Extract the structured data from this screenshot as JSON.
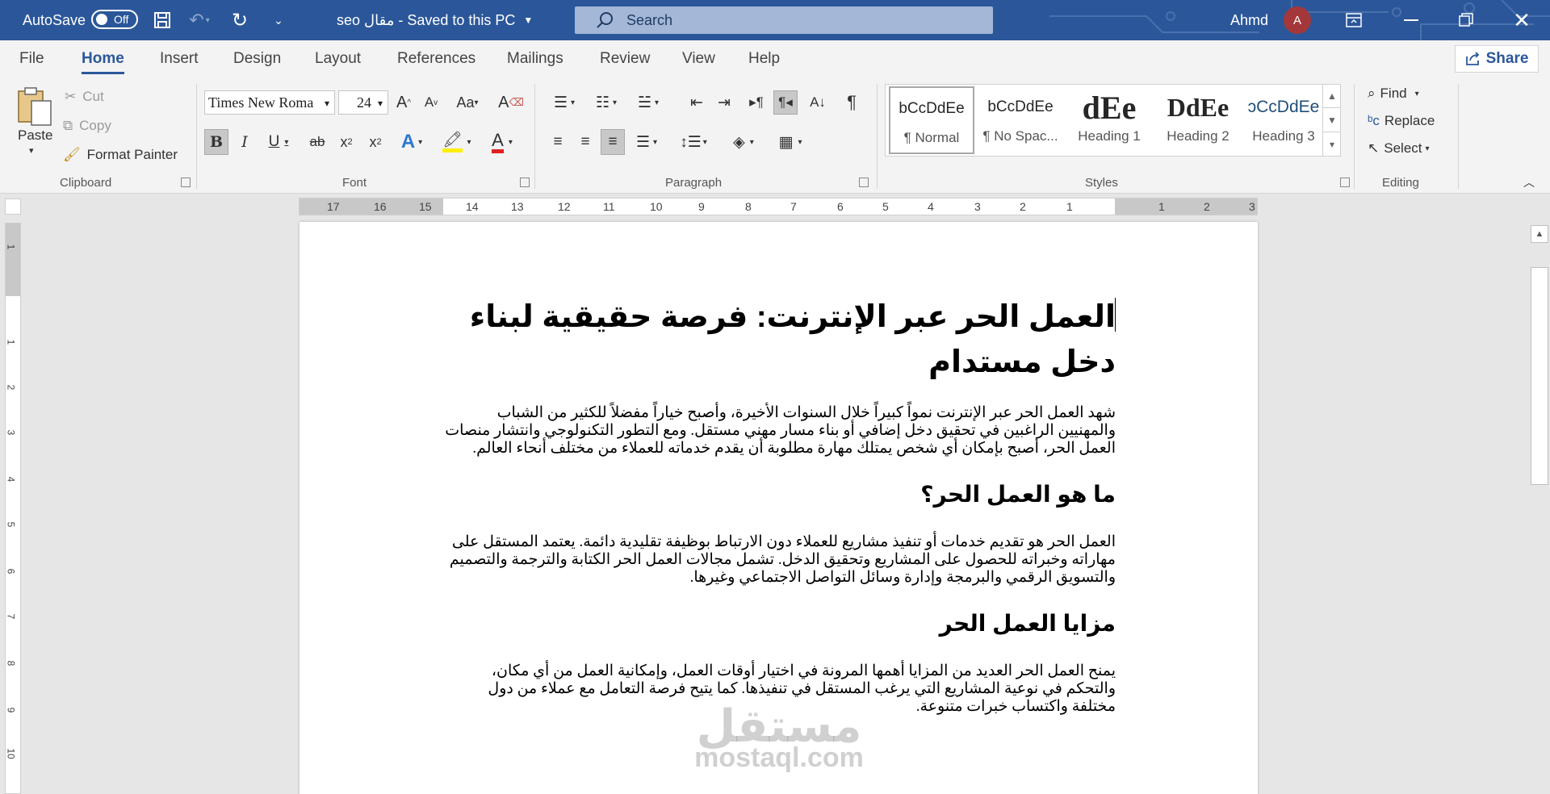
{
  "titlebar": {
    "autosave_label": "AutoSave",
    "autosave_state": "Off",
    "doc_title": "seo مقال  -  Saved to this PC",
    "search_placeholder": "Search",
    "user_name": "Ahmd",
    "user_initial": "A"
  },
  "menu": {
    "tabs": [
      "File",
      "Home",
      "Insert",
      "Design",
      "Layout",
      "References",
      "Mailings",
      "Review",
      "View",
      "Help"
    ],
    "share_label": "Share"
  },
  "ribbon": {
    "clipboard": {
      "paste": "Paste",
      "cut": "Cut",
      "copy": "Copy",
      "format_painter": "Format Painter",
      "label": "Clipboard"
    },
    "font": {
      "font_name": "Times New Roma",
      "font_size": "24",
      "label": "Font"
    },
    "paragraph": {
      "label": "Paragraph"
    },
    "styles": {
      "label": "Styles",
      "items": [
        {
          "preview": "bCcDdEe",
          "name": "¶ Normal"
        },
        {
          "preview": "bCcDdEe",
          "name": "¶ No Spac..."
        },
        {
          "preview": "dEe",
          "name": "Heading 1"
        },
        {
          "preview": "DdEe",
          "name": "Heading 2"
        },
        {
          "preview": "ɔCcDdEe",
          "name": "Heading 3"
        }
      ]
    },
    "editing": {
      "find": "Find",
      "replace": "Replace",
      "select": "Select",
      "label": "Editing"
    }
  },
  "ruler": {
    "h_numbers": [
      "17",
      "16",
      "15",
      "14",
      "13",
      "12",
      "11",
      "10",
      "9",
      "8",
      "7",
      "6",
      "5",
      "4",
      "3",
      "2",
      "1",
      "1",
      "2",
      "3"
    ],
    "v_numbers": [
      "1",
      "1",
      "2",
      "3",
      "4",
      "5",
      "6",
      "7",
      "8",
      "9",
      "10"
    ]
  },
  "document": {
    "title": "العمل الحر عبر الإنترنت: فرصة حقيقية لبناء دخل مستدام",
    "intro": "شهد العمل الحر عبر الإنترنت نمواً كبيراً خلال السنوات الأخيرة، وأصبح خياراً مفضلاً للكثير من الشباب والمهنيين الراغبين في تحقيق دخل إضافي أو بناء مسار مهني مستقل. ومع التطور التكنولوجي وانتشار منصات العمل الحر، أصبح بإمكان أي شخص يمتلك مهارة مطلوبة أن يقدم خدماته للعملاء من مختلف أنحاء العالم.",
    "h2_1": "ما هو العمل الحر؟",
    "p1": "العمل الحر هو تقديم خدمات أو تنفيذ مشاريع للعملاء دون الارتباط بوظيفة تقليدية دائمة. يعتمد المستقل على مهاراته وخبراته للحصول على المشاريع وتحقيق الدخل. تشمل مجالات العمل الحر الكتابة والترجمة والتصميم والتسويق الرقمي والبرمجة وإدارة وسائل التواصل الاجتماعي وغيرها.",
    "h2_2": "مزايا العمل الحر",
    "p2": "يمنح العمل الحر العديد من المزايا أهمها المرونة في اختيار أوقات العمل، وإمكانية العمل من أي مكان، والتحكم في نوعية المشاريع التي يرغب المستقل في تنفيذها. كما يتيح فرصة التعامل مع عملاء من دول مختلفة واكتساب خبرات متنوعة."
  },
  "watermark": {
    "arabic": "مستقل",
    "latin": "mostaql.com"
  }
}
